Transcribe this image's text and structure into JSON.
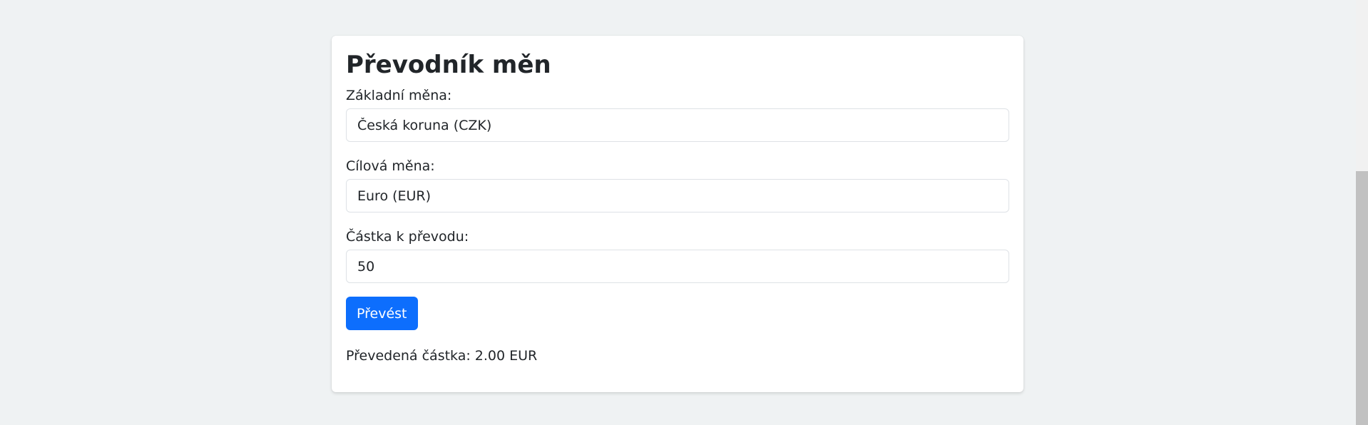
{
  "converter": {
    "title": "Převodník měn",
    "base_currency": {
      "label": "Základní měna:",
      "value": "Česká koruna (CZK)"
    },
    "target_currency": {
      "label": "Cílová měna:",
      "value": "Euro (EUR)"
    },
    "amount": {
      "label": "Částka k převodu:",
      "value": "50"
    },
    "convert_button": "Převést",
    "result": "Převedená částka: 2.00 EUR"
  },
  "colors": {
    "page_background": "#eff2f3",
    "button_background": "#0d6efd",
    "button_text": "#ffffff",
    "text": "#212529"
  }
}
